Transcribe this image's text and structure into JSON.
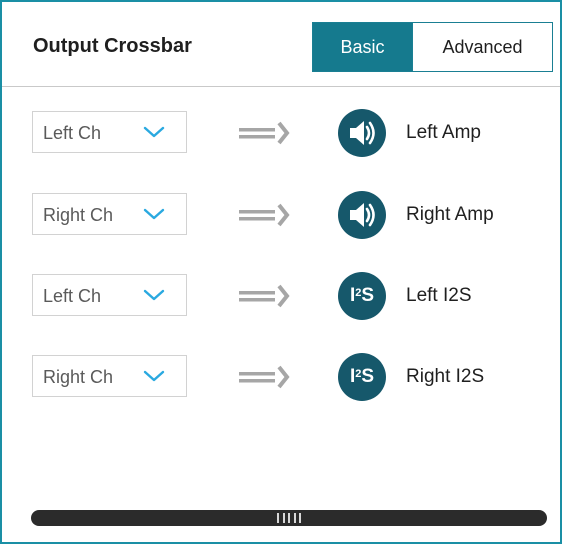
{
  "header": {
    "title": "Output Crossbar",
    "toggle": {
      "basic_label": "Basic",
      "advanced_label": "Advanced",
      "selected": "Basic"
    }
  },
  "routes": [
    {
      "source": "Left Ch",
      "output_label": "Left Amp",
      "output_icon": "speaker-icon"
    },
    {
      "source": "Right Ch",
      "output_label": "Right Amp",
      "output_icon": "speaker-icon"
    },
    {
      "source": "Left Ch",
      "output_label": "Left I2S",
      "output_icon": "i2s-icon"
    },
    {
      "source": "Right Ch",
      "output_label": "Right I2S",
      "output_icon": "i2s-icon"
    }
  ],
  "colors": {
    "accent": "#157a8e",
    "panel_border": "#1a8fa5",
    "icon_fill": "#16586b",
    "chevron": "#2aa9e0",
    "arrow": "#a6a6a6",
    "scrollbar": "#2b2b2b"
  }
}
